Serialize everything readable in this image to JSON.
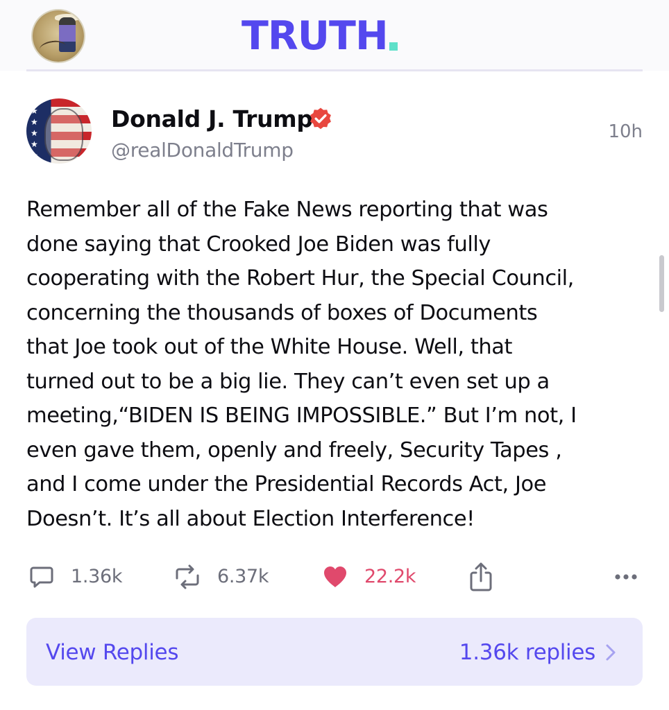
{
  "header": {
    "logo_text": "TRUTH",
    "logo_dot": "."
  },
  "post": {
    "author_name": "Donald J. Trump",
    "author_handle": "@realDonaldTrump",
    "timestamp": "10h",
    "body": "Remember all of the Fake News reporting that was\ndone saying that Crooked Joe Biden was fully\ncooperating with the Robert Hur, the Special Council,\nconcerning the thousands of boxes of Documents\nthat Joe took out of the White House. Well, that\nturned out to be a big lie. They can’t even set up a\nmeeting,“BIDEN IS BEING IMPOSSIBLE.” But I’m not, I\neven gave them, openly and freely, Security Tapes ,\nand I come under the Presidential Records Act, Joe\nDoesn’t. It’s all about Election Interference!"
  },
  "actions": {
    "replies_count": "1.36k",
    "retruths_count": "6.37k",
    "likes_count": "22.2k",
    "share_icon": "share-icon",
    "more_icon": "more-icon"
  },
  "replies": {
    "view_label": "View Replies",
    "count_label": "1.36k replies"
  },
  "colors": {
    "brand": "#5448ee",
    "brand_accent": "#5ee0c9",
    "like": "#e0496c",
    "verified": "#e8473f",
    "muted": "#7d7f8c",
    "replies_bg": "#ebeafc"
  }
}
